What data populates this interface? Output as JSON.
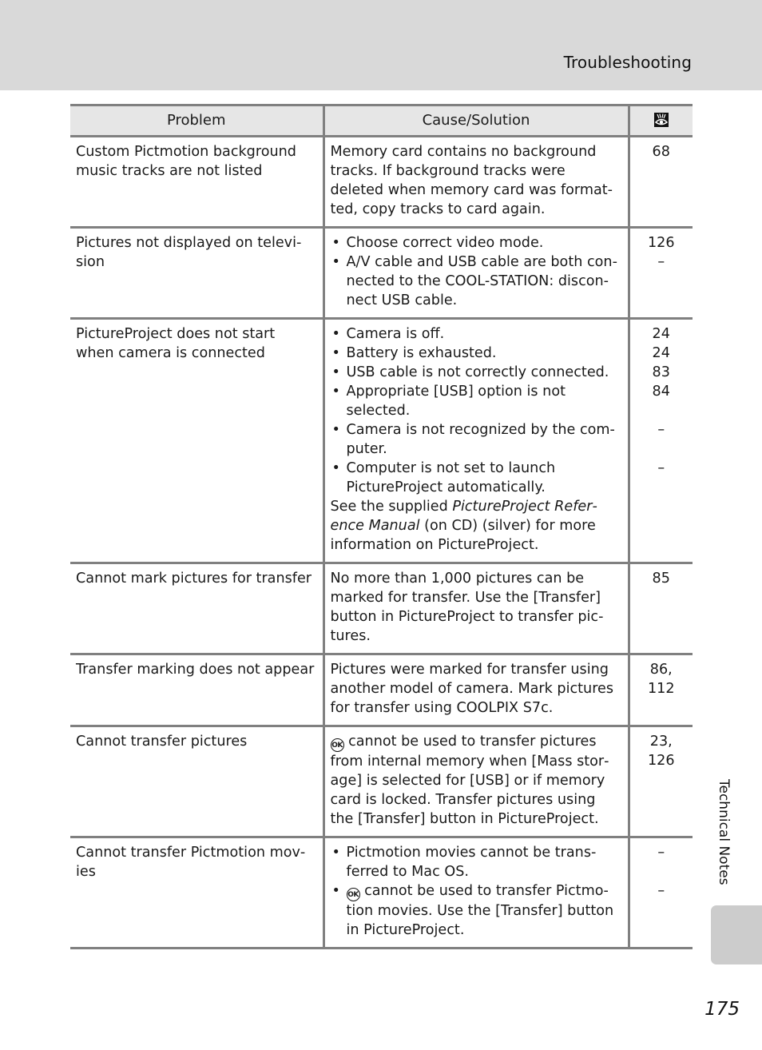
{
  "header": {
    "section_title": "Troubleshooting"
  },
  "table": {
    "columns": {
      "problem": "Problem",
      "cause_solution": "Cause/Solution",
      "reference_icon": "page-reference-icon"
    },
    "rows": [
      {
        "problem": "Custom Pictmotion background music tracks are not listed",
        "solution_text": "Memory card contains no background tracks. If background tracks were deleted when memory card was format­ted, copy tracks to card again.",
        "refs": [
          "68"
        ]
      },
      {
        "problem": "Pictures not displayed on televi­sion",
        "bullets": [
          "Choose correct video mode.",
          "A/V cable and USB cable are both con­nected to the COOL-STATION: discon­nect USB cable."
        ],
        "refs": [
          "126",
          "–"
        ]
      },
      {
        "problem": "PictureProject does not start when camera is connected",
        "bullets": [
          "Camera is off.",
          "Battery is exhausted.",
          "USB cable is not correctly connected.",
          "Appropriate [USB] option is not selected.",
          "Camera is not recognized by the com­puter.",
          "Computer is not set to launch PictureProject automatically."
        ],
        "note_prefix": "See the supplied ",
        "note_italic": "PictureProject Refer­ence Manual",
        "note_suffix": " (on CD) (silver) for more information on PictureProject.",
        "refs": [
          "24",
          "24",
          "83",
          "84",
          "",
          "–",
          "",
          "–"
        ]
      },
      {
        "problem": "Cannot mark pictures for transfer",
        "solution_text": "No more than 1,000 pictures can be marked for transfer. Use the [Transfer] button in PictureProject to transfer pic­tures.",
        "refs": [
          "85"
        ]
      },
      {
        "problem": "Transfer marking does not appear",
        "solution_text": "Pictures were marked for transfer using another model of camera. Mark pictures for transfer using COOLPIX S7c.",
        "refs": [
          "86,",
          "112"
        ]
      },
      {
        "problem": "Cannot transfer pictures",
        "ok_label": "OK",
        "solution_text": " cannot be used to transfer pictures from internal memory when [Mass stor­age] is selected for [USB] or if memory card is locked. Transfer pictures using the [Transfer] button in PictureProject.",
        "refs": [
          "23,",
          "126"
        ]
      },
      {
        "problem": "Cannot transfer Pictmotion mov­ies",
        "bullets": [
          "Pictmotion movies cannot be trans­ferred to Mac OS."
        ],
        "ok_label": "OK",
        "bullet2_text": " cannot be used to transfer Pictmo­tion movies. Use the [Transfer] button in PictureProject.",
        "refs": [
          "–",
          "",
          "–"
        ]
      }
    ]
  },
  "side_tab": {
    "label": "Technical Notes"
  },
  "footer": {
    "page_number": "175"
  },
  "colors": {
    "header_band": "#d9d9d9",
    "table_header_bg": "#e6e6e6",
    "rule": "#808080",
    "side_tab": "#cccccc"
  }
}
